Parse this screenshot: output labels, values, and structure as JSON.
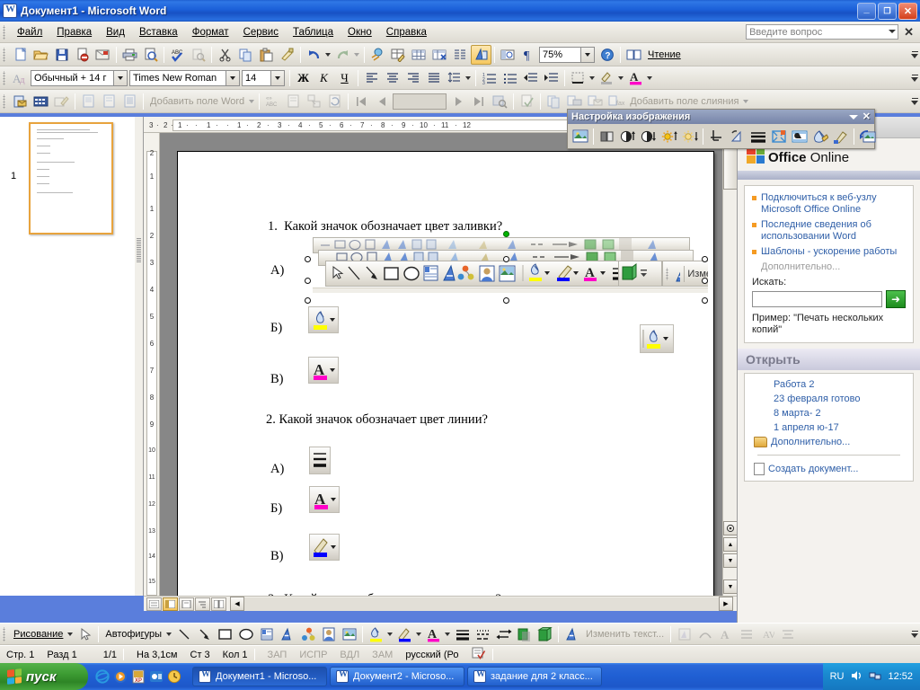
{
  "window": {
    "title": "Документ1 - Microsoft Word",
    "app_icon": "word-document-icon",
    "minimize_label": "_",
    "maximize_label": "□",
    "close_label": "✕"
  },
  "menubar": {
    "items": [
      {
        "label": "Файл"
      },
      {
        "label": "Правка"
      },
      {
        "label": "Вид"
      },
      {
        "label": "Вставка"
      },
      {
        "label": "Формат"
      },
      {
        "label": "Сервис"
      },
      {
        "label": "Таблица"
      },
      {
        "label": "Окно"
      },
      {
        "label": "Справка"
      }
    ],
    "ask_placeholder": "Введите вопрос",
    "close_label": "✕"
  },
  "toolbars": {
    "standard": {
      "zoom_value": "75%",
      "reading_label": "Чтение",
      "buttons": [
        "new-document-icon",
        "open-folder-icon",
        "save-icon",
        "permission-icon",
        "email-icon",
        "print-icon",
        "print-preview-icon",
        "spelling-check-icon",
        "research-icon",
        "cut-scissors-icon",
        "copy-icon",
        "paste-icon",
        "format-painter-icon",
        "undo-icon",
        "redo-icon",
        "insert-hyperlink-icon",
        "tables-and-borders-icon",
        "insert-table-icon",
        "insert-excel-table-icon",
        "columns-icon",
        "drawing-icon",
        "document-map-icon",
        "show-formatting-marks-icon",
        "help-icon"
      ]
    },
    "formatting": {
      "style_value": "Обычный + 14 г",
      "font_value": "Times New Roman",
      "size_value": "14",
      "bold_label": "Ж",
      "italic_label": "К",
      "underline_label": "Ч",
      "buttons": [
        "style-icon",
        "align-left-icon",
        "align-center-icon",
        "align-right-icon",
        "justify-icon",
        "line-spacing-icon",
        "numbered-list-icon",
        "bulleted-list-icon",
        "decrease-indent-icon",
        "increase-indent-icon",
        "borders-icon",
        "highlight-color-icon",
        "font-color-icon"
      ]
    },
    "mail_merge": {
      "add_word_field_label": "Добавить поле Word",
      "add_merge_field_label": "Добавить поле слияния",
      "record_value": "",
      "buttons": [
        "main-document-setup-icon",
        "open-data-source-icon",
        "edit-recipients-icon",
        "envelopes-icon",
        "labels-icon",
        "insert-word-field-icon",
        "view-merged-data-icon",
        "highlight-merge-fields-icon",
        "match-fields-icon",
        "propagate-labels-icon",
        "first-record-icon",
        "previous-record-icon",
        "next-record-icon",
        "last-record-icon",
        "find-entry-icon",
        "check-errors-icon",
        "merge-to-new-document-icon",
        "merge-to-printer-icon",
        "merge-to-email-icon",
        "merge-to-fax-icon"
      ]
    }
  },
  "picture_toolbar": {
    "title": "Настройка изображения",
    "collapse_label": "▼",
    "close_label": "✕",
    "buttons": [
      "insert-picture-icon",
      "color-mode-icon",
      "more-contrast-icon",
      "less-contrast-icon",
      "more-brightness-icon",
      "less-brightness-icon",
      "crop-icon",
      "rotate-left-icon",
      "line-style-icon",
      "compress-pictures-icon",
      "text-wrapping-icon",
      "format-picture-icon",
      "set-transparent-color-icon",
      "reset-picture-icon"
    ]
  },
  "thumbnail_pane": {
    "page_number": "1"
  },
  "ruler": {
    "horizontal_ticks": [
      "3",
      "2",
      "1",
      "1",
      "1",
      "2",
      "3",
      "4",
      "5",
      "6",
      "7",
      "8",
      "9",
      "10",
      "11",
      "12"
    ],
    "vertical_ticks": [
      "2",
      "1",
      "1",
      "2",
      "3",
      "4",
      "5",
      "6",
      "7",
      "8",
      "9",
      "10",
      "11",
      "12",
      "13",
      "14",
      "15"
    ]
  },
  "document": {
    "questions": [
      {
        "number": "1.",
        "text": "Какой значок обозначает цвет заливки?",
        "options": [
          {
            "label": "А)",
            "icon": "drawing-toolbar-image"
          },
          {
            "label": "Б)",
            "icon": "fill-color-icon"
          },
          {
            "label": "В)",
            "icon": "font-color-icon"
          }
        ]
      },
      {
        "number": "2.",
        "text": "Какой значок обозначает цвет линии?",
        "options": [
          {
            "label": "А)",
            "icon": "line-style-icon"
          },
          {
            "label": "Б)",
            "icon": "font-color-icon"
          },
          {
            "label": "В)",
            "icon": "line-color-icon"
          }
        ]
      },
      {
        "number": "3.",
        "text": "Какой значок обозначает копирование?",
        "options": []
      }
    ],
    "floating_image_label": "Изменить",
    "stray_icon": "fill-color-icon"
  },
  "task_pane": {
    "logo_microsoft": "Microsoft",
    "logo_office": "Office",
    "logo_online": "Online",
    "links": [
      "Подключиться к веб-узлу Microsoft Office Online",
      "Последние сведения об использовании Word",
      "Шаблоны - ускорение работы"
    ],
    "more_label": "Дополнительно...",
    "search_label": "Искать:",
    "search_value": "",
    "go_label": "➜",
    "example_label": "Пример: \"Печать нескольких копий\"",
    "open_header": "Открыть",
    "open_items": [
      "Работа 2",
      "23 февраля готово",
      "8 марта- 2",
      "1 апреля ю-17"
    ],
    "open_more_label": "Дополнительно...",
    "new_document_label": "Создать документ...",
    "back_label": "◀",
    "forward_label": "▶",
    "home_label": "⌂"
  },
  "drawing_toolbar": {
    "draw_label": "Рисование",
    "autoshapes_label": "Автофигуры",
    "change_text_label": "Изменить текст...",
    "buttons": [
      "select-objects-icon",
      "line-icon",
      "arrow-icon",
      "rectangle-icon",
      "oval-icon",
      "text-box-icon",
      "wordart-icon",
      "diagram-icon",
      "clip-art-icon",
      "picture-icon",
      "fill-color-icon",
      "line-color-icon",
      "font-color-icon",
      "line-style-icon",
      "dash-style-icon",
      "arrow-style-icon",
      "shadow-style-icon",
      "3d-style-icon",
      "insert-wordart-icon",
      "font-color-icon",
      "align-icon",
      "character-spacing-icon"
    ]
  },
  "status_bar": {
    "page_label": "Стр. 1",
    "section_label": "Разд 1",
    "pages_label": "1/1",
    "position_label": "На 3,1см",
    "line_label": "Ст 3",
    "column_label": "Кол 1",
    "rec_label": "ЗАП",
    "trk_label": "ИСПР",
    "ext_label": "ВДЛ",
    "ovr_label": "ЗАМ",
    "language_label": "русский (Ро",
    "spellcheck_icon": "spelling-status-icon"
  },
  "taskbar": {
    "start_label": "пуск",
    "quick_launch": [
      "internet-explorer-icon",
      "media-player-icon",
      "winzip-icon",
      "outlook-icon",
      "clock-icon"
    ],
    "tasks": [
      {
        "label": "Документ1 - Microso...",
        "active": true
      },
      {
        "label": "Документ2 - Microso...",
        "active": false
      },
      {
        "label": "задание для 2 класс...",
        "active": false
      }
    ],
    "tray_language": "RU",
    "tray_clock": "12:52",
    "tray_icons": [
      "volume-icon",
      "network-icon"
    ]
  }
}
